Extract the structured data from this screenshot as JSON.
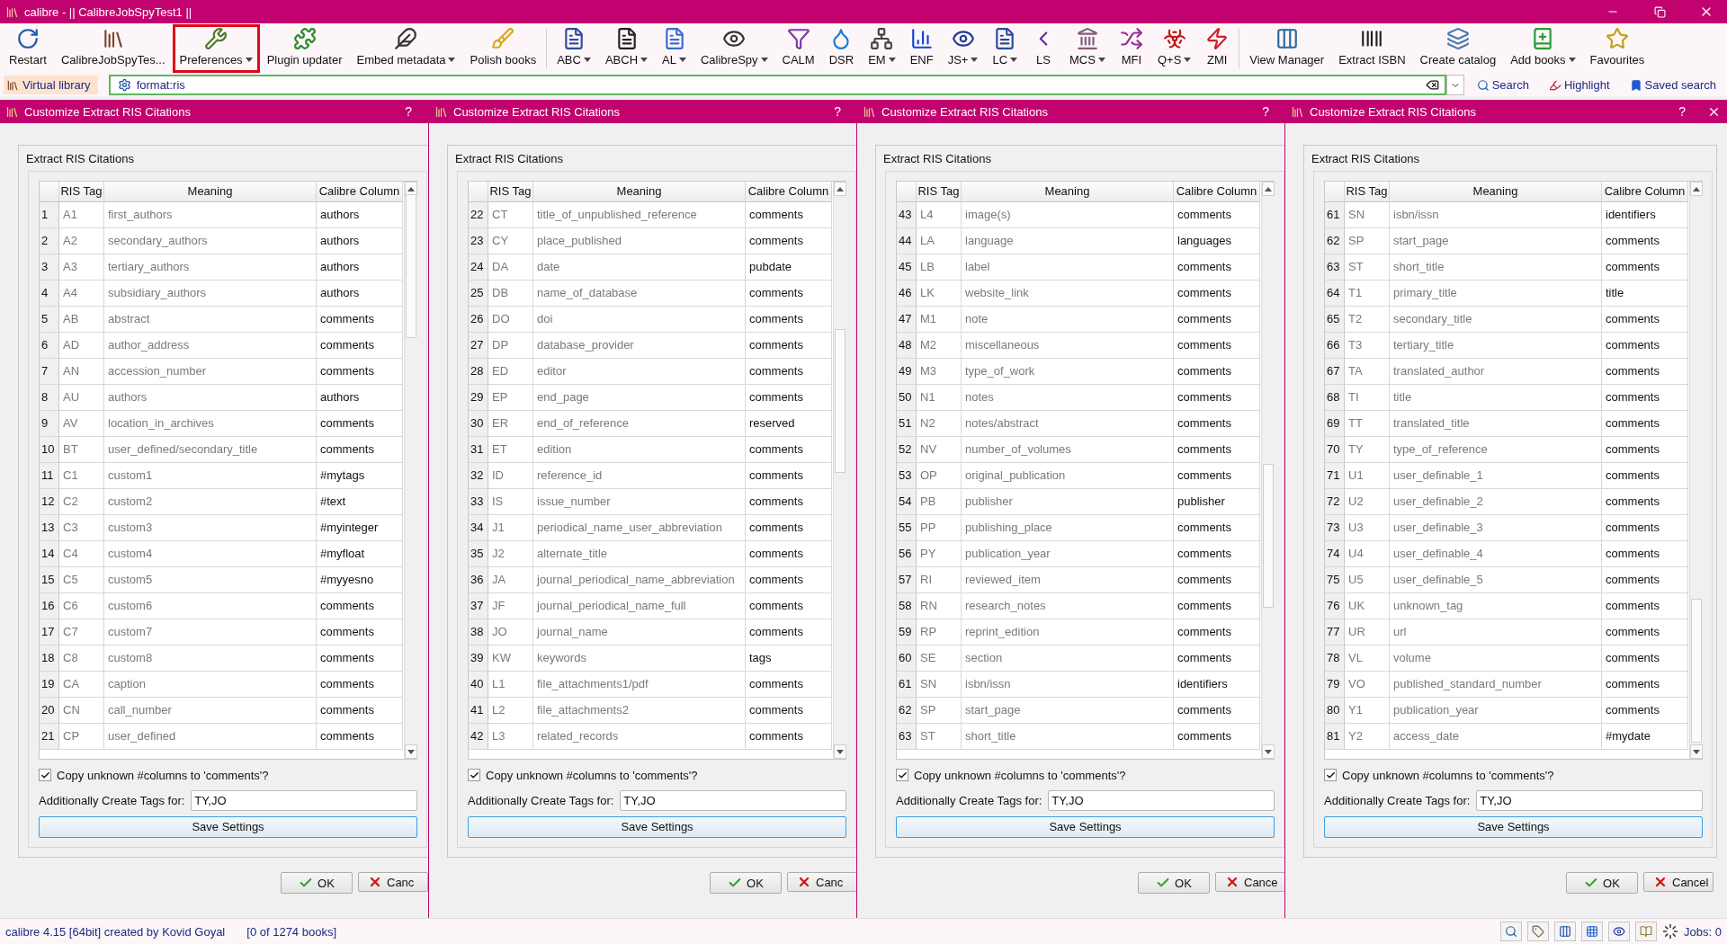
{
  "window": {
    "title": "calibre - || CalibreJobSpyTest1 ||"
  },
  "toolbar": [
    {
      "kind": "button",
      "label": "Restart",
      "dropdown": false,
      "highlighted": false
    },
    {
      "kind": "button",
      "label": "CalibreJobSpyTes...",
      "dropdown": false,
      "highlighted": false
    },
    {
      "kind": "button",
      "label": "Preferences",
      "dropdown": true,
      "highlighted": true
    },
    {
      "kind": "button",
      "label": "Plugin updater",
      "dropdown": false,
      "highlighted": false
    },
    {
      "kind": "button",
      "label": "Embed metadata",
      "dropdown": true,
      "highlighted": false
    },
    {
      "kind": "button",
      "label": "Polish books",
      "dropdown": false,
      "highlighted": false
    },
    {
      "kind": "separator"
    },
    {
      "kind": "button",
      "label": "ABC",
      "dropdown": true,
      "highlighted": false
    },
    {
      "kind": "button",
      "label": "ABCH",
      "dropdown": true,
      "highlighted": false
    },
    {
      "kind": "button",
      "label": "AL",
      "dropdown": true,
      "highlighted": false
    },
    {
      "kind": "button",
      "label": "CalibreSpy",
      "dropdown": true,
      "highlighted": false
    },
    {
      "kind": "button",
      "label": "CALM",
      "dropdown": false,
      "highlighted": false
    },
    {
      "kind": "button",
      "label": "DSR",
      "dropdown": false,
      "highlighted": false
    },
    {
      "kind": "button",
      "label": "EM",
      "dropdown": true,
      "highlighted": false
    },
    {
      "kind": "button",
      "label": "ENF",
      "dropdown": false,
      "highlighted": false
    },
    {
      "kind": "button",
      "label": "JS+",
      "dropdown": true,
      "highlighted": false
    },
    {
      "kind": "button",
      "label": "LC",
      "dropdown": true,
      "highlighted": false
    },
    {
      "kind": "button",
      "label": "LS",
      "dropdown": false,
      "highlighted": false
    },
    {
      "kind": "button",
      "label": "MCS",
      "dropdown": true,
      "highlighted": false
    },
    {
      "kind": "button",
      "label": "MFI",
      "dropdown": false,
      "highlighted": false
    },
    {
      "kind": "button",
      "label": "Q+S",
      "dropdown": true,
      "highlighted": false
    },
    {
      "kind": "button",
      "label": "ZMI",
      "dropdown": false,
      "highlighted": false
    },
    {
      "kind": "separator"
    },
    {
      "kind": "button",
      "label": "View Manager",
      "dropdown": false,
      "highlighted": false
    },
    {
      "kind": "button",
      "label": "Extract ISBN",
      "dropdown": false,
      "highlighted": false
    },
    {
      "kind": "button",
      "label": "Create catalog",
      "dropdown": false,
      "highlighted": false
    },
    {
      "kind": "button",
      "label": "Add books",
      "dropdown": true,
      "highlighted": false
    },
    {
      "kind": "button",
      "label": "Favourites",
      "dropdown": false,
      "highlighted": false
    }
  ],
  "search_bar": {
    "virtual_library": "Virtual library",
    "value": "format:ris",
    "search": "Search",
    "highlight": "Highlight",
    "saved_search": "Saved search"
  },
  "dialogs": [
    {
      "title": "Customize Extract RIS Citations",
      "help": "?",
      "close_button": false,
      "group_title": "Extract RIS Citations",
      "columns": [
        "RIS Tag",
        "Meaning",
        "Calibre Column"
      ],
      "rows": [
        {
          "n": "1",
          "tag": "A1",
          "meaning": "first_authors",
          "column": "authors"
        },
        {
          "n": "2",
          "tag": "A2",
          "meaning": "secondary_authors",
          "column": "authors"
        },
        {
          "n": "3",
          "tag": "A3",
          "meaning": "tertiary_authors",
          "column": "authors"
        },
        {
          "n": "4",
          "tag": "A4",
          "meaning": "subsidiary_authors",
          "column": "authors"
        },
        {
          "n": "5",
          "tag": "AB",
          "meaning": "abstract",
          "column": "comments"
        },
        {
          "n": "6",
          "tag": "AD",
          "meaning": "author_address",
          "column": "comments"
        },
        {
          "n": "7",
          "tag": "AN",
          "meaning": "accession_number",
          "column": "comments"
        },
        {
          "n": "8",
          "tag": "AU",
          "meaning": "authors",
          "column": "authors"
        },
        {
          "n": "9",
          "tag": "AV",
          "meaning": "location_in_archives",
          "column": "comments"
        },
        {
          "n": "10",
          "tag": "BT",
          "meaning": "user_defined/secondary_title",
          "column": "comments"
        },
        {
          "n": "11",
          "tag": "C1",
          "meaning": "custom1",
          "column": "#mytags"
        },
        {
          "n": "12",
          "tag": "C2",
          "meaning": "custom2",
          "column": "#text"
        },
        {
          "n": "13",
          "tag": "C3",
          "meaning": "custom3",
          "column": "#myinteger"
        },
        {
          "n": "14",
          "tag": "C4",
          "meaning": "custom4",
          "column": "#myfloat"
        },
        {
          "n": "15",
          "tag": "C5",
          "meaning": "custom5",
          "column": "#myyesno"
        },
        {
          "n": "16",
          "tag": "C6",
          "meaning": "custom6",
          "column": "comments"
        },
        {
          "n": "17",
          "tag": "C7",
          "meaning": "custom7",
          "column": "comments"
        },
        {
          "n": "18",
          "tag": "C8",
          "meaning": "custom8",
          "column": "comments"
        },
        {
          "n": "19",
          "tag": "CA",
          "meaning": "caption",
          "column": "comments"
        },
        {
          "n": "20",
          "tag": "CN",
          "meaning": "call_number",
          "column": "comments"
        },
        {
          "n": "21",
          "tag": "CP",
          "meaning": "user_defined",
          "column": "comments"
        }
      ],
      "copy_unknown": {
        "label": "Copy unknown #columns to 'comments'?",
        "checked": true
      },
      "tags_label": "Additionally Create Tags for:",
      "tags_value": "TY,JO",
      "save": "Save Settings",
      "ok": "OK",
      "cancel": "Canc"
    },
    {
      "title": "Customize Extract RIS Citations",
      "help": "?",
      "close_button": false,
      "group_title": "Extract RIS Citations",
      "columns": [
        "RIS Tag",
        "Meaning",
        "Calibre Column"
      ],
      "rows": [
        {
          "n": "22",
          "tag": "CT",
          "meaning": "title_of_unpublished_reference",
          "column": "comments"
        },
        {
          "n": "23",
          "tag": "CY",
          "meaning": "place_published",
          "column": "comments"
        },
        {
          "n": "24",
          "tag": "DA",
          "meaning": "date",
          "column": "pubdate"
        },
        {
          "n": "25",
          "tag": "DB",
          "meaning": "name_of_database",
          "column": "comments"
        },
        {
          "n": "26",
          "tag": "DO",
          "meaning": "doi",
          "column": "comments"
        },
        {
          "n": "27",
          "tag": "DP",
          "meaning": "database_provider",
          "column": "comments"
        },
        {
          "n": "28",
          "tag": "ED",
          "meaning": "editor",
          "column": "comments"
        },
        {
          "n": "29",
          "tag": "EP",
          "meaning": "end_page",
          "column": "comments"
        },
        {
          "n": "30",
          "tag": "ER",
          "meaning": "end_of_reference",
          "column": "reserved"
        },
        {
          "n": "31",
          "tag": "ET",
          "meaning": "edition",
          "column": "comments"
        },
        {
          "n": "32",
          "tag": "ID",
          "meaning": "reference_id",
          "column": "comments"
        },
        {
          "n": "33",
          "tag": "IS",
          "meaning": "issue_number",
          "column": "comments"
        },
        {
          "n": "34",
          "tag": "J1",
          "meaning": "periodical_name_user_abbreviation",
          "column": "comments"
        },
        {
          "n": "35",
          "tag": "J2",
          "meaning": "alternate_title",
          "column": "comments"
        },
        {
          "n": "36",
          "tag": "JA",
          "meaning": "journal_periodical_name_abbreviation",
          "column": "comments"
        },
        {
          "n": "37",
          "tag": "JF",
          "meaning": "journal_periodical_name_full",
          "column": "comments"
        },
        {
          "n": "38",
          "tag": "JO",
          "meaning": "journal_name",
          "column": "comments"
        },
        {
          "n": "39",
          "tag": "KW",
          "meaning": "keywords",
          "column": "tags"
        },
        {
          "n": "40",
          "tag": "L1",
          "meaning": "file_attachments1/pdf",
          "column": "comments"
        },
        {
          "n": "41",
          "tag": "L2",
          "meaning": "file_attachments2",
          "column": "comments"
        },
        {
          "n": "42",
          "tag": "L3",
          "meaning": "related_records",
          "column": "comments"
        }
      ],
      "copy_unknown": {
        "label": "Copy unknown #columns to 'comments'?",
        "checked": true
      },
      "tags_label": "Additionally Create Tags for:",
      "tags_value": "TY,JO",
      "save": "Save Settings",
      "ok": "OK",
      "cancel": "Canc"
    },
    {
      "title": "Customize Extract RIS Citations",
      "help": "?",
      "close_button": false,
      "group_title": "Extract RIS Citations",
      "columns": [
        "RIS Tag",
        "Meaning",
        "Calibre Column"
      ],
      "rows": [
        {
          "n": "43",
          "tag": "L4",
          "meaning": "image(s)",
          "column": "comments"
        },
        {
          "n": "44",
          "tag": "LA",
          "meaning": "language",
          "column": "languages"
        },
        {
          "n": "45",
          "tag": "LB",
          "meaning": "label",
          "column": "comments"
        },
        {
          "n": "46",
          "tag": "LK",
          "meaning": "website_link",
          "column": "comments"
        },
        {
          "n": "47",
          "tag": "M1",
          "meaning": "note",
          "column": "comments"
        },
        {
          "n": "48",
          "tag": "M2",
          "meaning": "miscellaneous",
          "column": "comments"
        },
        {
          "n": "49",
          "tag": "M3",
          "meaning": "type_of_work",
          "column": "comments"
        },
        {
          "n": "50",
          "tag": "N1",
          "meaning": "notes",
          "column": "comments"
        },
        {
          "n": "51",
          "tag": "N2",
          "meaning": "notes/abstract",
          "column": "comments"
        },
        {
          "n": "52",
          "tag": "NV",
          "meaning": "number_of_volumes",
          "column": "comments"
        },
        {
          "n": "53",
          "tag": "OP",
          "meaning": "original_publication",
          "column": "comments"
        },
        {
          "n": "54",
          "tag": "PB",
          "meaning": "publisher",
          "column": "publisher"
        },
        {
          "n": "55",
          "tag": "PP",
          "meaning": "publishing_place",
          "column": "comments"
        },
        {
          "n": "56",
          "tag": "PY",
          "meaning": "publication_year",
          "column": "comments"
        },
        {
          "n": "57",
          "tag": "RI",
          "meaning": "reviewed_item",
          "column": "comments"
        },
        {
          "n": "58",
          "tag": "RN",
          "meaning": "research_notes",
          "column": "comments"
        },
        {
          "n": "59",
          "tag": "RP",
          "meaning": "reprint_edition",
          "column": "comments"
        },
        {
          "n": "60",
          "tag": "SE",
          "meaning": "section",
          "column": "comments"
        },
        {
          "n": "61",
          "tag": "SN",
          "meaning": "isbn/issn",
          "column": "identifiers"
        },
        {
          "n": "62",
          "tag": "SP",
          "meaning": "start_page",
          "column": "comments"
        },
        {
          "n": "63",
          "tag": "ST",
          "meaning": "short_title",
          "column": "comments"
        }
      ],
      "copy_unknown": {
        "label": "Copy unknown #columns to 'comments'?",
        "checked": true
      },
      "tags_label": "Additionally Create Tags for:",
      "tags_value": "TY,JO",
      "save": "Save Settings",
      "ok": "OK",
      "cancel": "Cance"
    },
    {
      "title": "Customize Extract RIS Citations",
      "help": "?",
      "close_button": true,
      "group_title": "Extract RIS Citations",
      "columns": [
        "RIS Tag",
        "Meaning",
        "Calibre Column"
      ],
      "rows": [
        {
          "n": "61",
          "tag": "SN",
          "meaning": "isbn/issn",
          "column": "identifiers"
        },
        {
          "n": "62",
          "tag": "SP",
          "meaning": "start_page",
          "column": "comments"
        },
        {
          "n": "63",
          "tag": "ST",
          "meaning": "short_title",
          "column": "comments"
        },
        {
          "n": "64",
          "tag": "T1",
          "meaning": "primary_title",
          "column": "title"
        },
        {
          "n": "65",
          "tag": "T2",
          "meaning": "secondary_title",
          "column": "comments"
        },
        {
          "n": "66",
          "tag": "T3",
          "meaning": "tertiary_title",
          "column": "comments"
        },
        {
          "n": "67",
          "tag": "TA",
          "meaning": "translated_author",
          "column": "comments"
        },
        {
          "n": "68",
          "tag": "TI",
          "meaning": "title",
          "column": "comments"
        },
        {
          "n": "69",
          "tag": "TT",
          "meaning": "translated_title",
          "column": "comments"
        },
        {
          "n": "70",
          "tag": "TY",
          "meaning": "type_of_reference",
          "column": "comments"
        },
        {
          "n": "71",
          "tag": "U1",
          "meaning": "user_definable_1",
          "column": "comments"
        },
        {
          "n": "72",
          "tag": "U2",
          "meaning": "user_definable_2",
          "column": "comments"
        },
        {
          "n": "73",
          "tag": "U3",
          "meaning": "user_definable_3",
          "column": "comments"
        },
        {
          "n": "74",
          "tag": "U4",
          "meaning": "user_definable_4",
          "column": "comments"
        },
        {
          "n": "75",
          "tag": "U5",
          "meaning": "user_definable_5",
          "column": "comments"
        },
        {
          "n": "76",
          "tag": "UK",
          "meaning": "unknown_tag",
          "column": "comments"
        },
        {
          "n": "77",
          "tag": "UR",
          "meaning": "url",
          "column": "comments"
        },
        {
          "n": "78",
          "tag": "VL",
          "meaning": "volume",
          "column": "comments"
        },
        {
          "n": "79",
          "tag": "VO",
          "meaning": "published_standard_number",
          "column": "comments"
        },
        {
          "n": "80",
          "tag": "Y1",
          "meaning": "publication_year",
          "column": "comments"
        },
        {
          "n": "81",
          "tag": "Y2",
          "meaning": "access_date",
          "column": "#mydate"
        }
      ],
      "copy_unknown": {
        "label": "Copy unknown #columns to 'comments'?",
        "checked": true
      },
      "tags_label": "Additionally Create Tags for:",
      "tags_value": "TY,JO",
      "save": "Save Settings",
      "ok": "OK",
      "cancel": "Cancel"
    }
  ],
  "status_bar": {
    "credit": "calibre 4.15 [64bit] created by Kovid Goyal",
    "count": "[0 of 1274 books]",
    "jobs": "Jobs: 0"
  }
}
